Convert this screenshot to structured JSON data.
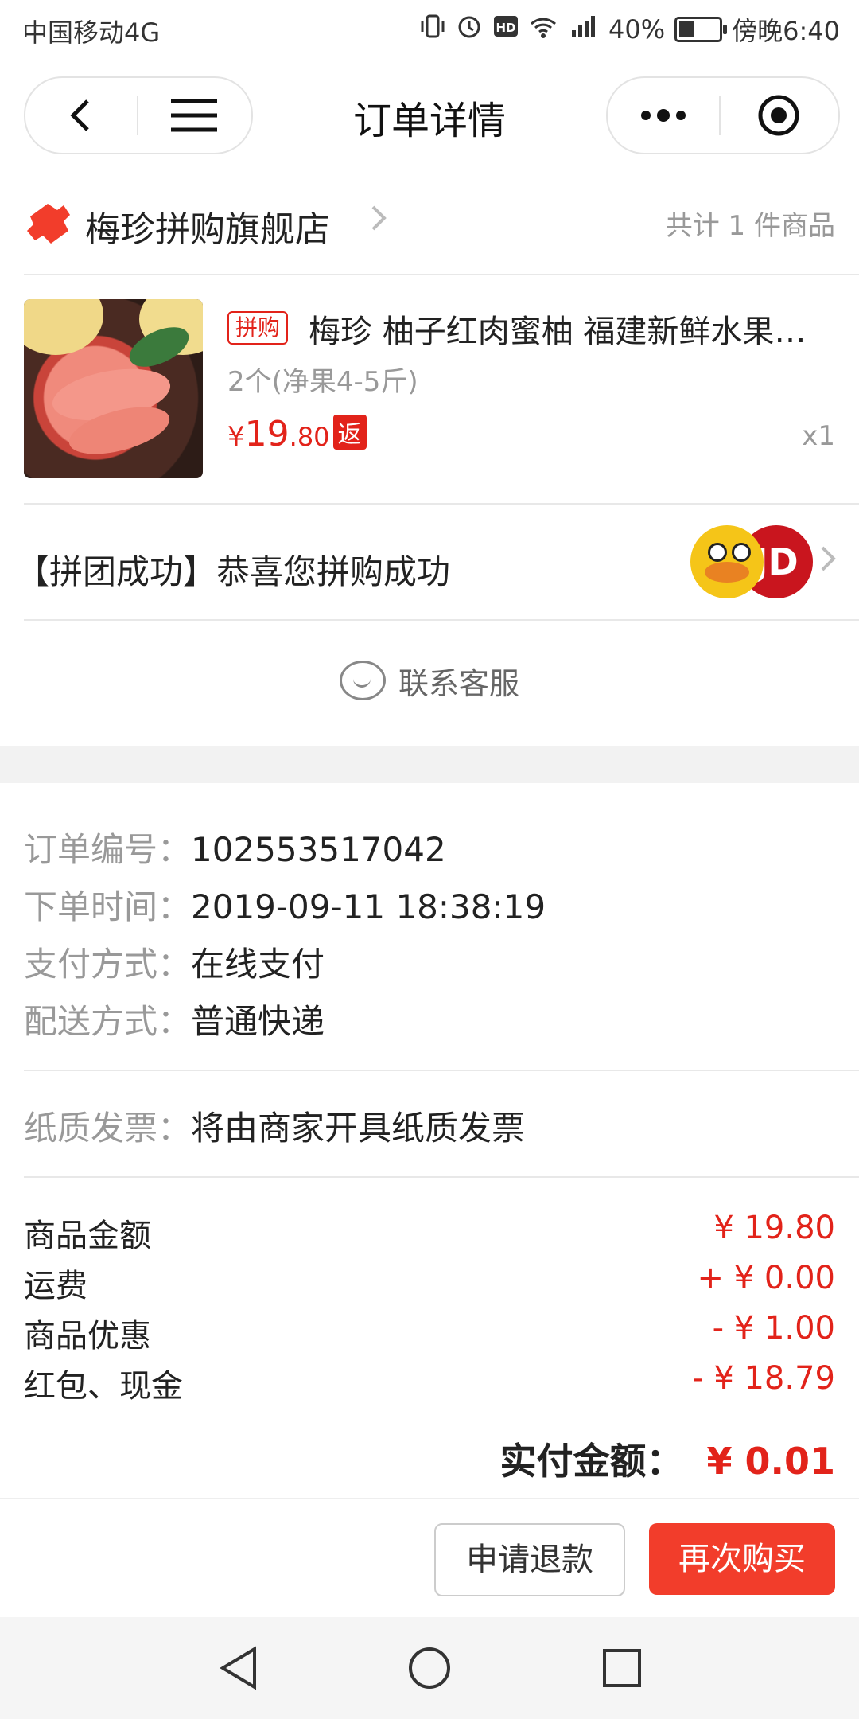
{
  "status_bar": {
    "carrier": "中国移动4G",
    "battery": "40%",
    "battery_fraction": 0.4,
    "time": "傍晚6:40"
  },
  "nav": {
    "title": "订单详情"
  },
  "store": {
    "name": "梅珍拼购旗舰店",
    "item_count": "共计 1 件商品"
  },
  "product": {
    "tag": "拼购",
    "title": "梅珍 柚子红肉蜜柚 福建新鲜水果应季",
    "spec": "2个(净果4-5斤)",
    "price_symbol": "¥",
    "price_int": "19",
    "price_dec": ".80",
    "rebate_tag": "返",
    "quantity": "x1"
  },
  "group": {
    "text": "【拼团成功】恭喜您拼购成功",
    "jd_avatar_text": "JD"
  },
  "contact": {
    "label": "联系客服"
  },
  "order_info": [
    {
      "label": "订单编号：",
      "value": "102553517042"
    },
    {
      "label": "下单时间：",
      "value": "2019-09-11 18:38:19"
    },
    {
      "label": "支付方式：",
      "value": "在线支付"
    },
    {
      "label": "配送方式：",
      "value": "普通快递"
    }
  ],
  "invoice": {
    "label": "纸质发票：",
    "value": "将由商家开具纸质发票"
  },
  "fees": [
    {
      "label": "商品金额",
      "value": "¥ 19.80"
    },
    {
      "label": "运费",
      "value": "+ ¥ 0.00"
    },
    {
      "label": "商品优惠",
      "value": "- ¥ 1.00"
    },
    {
      "label": "红包、现金",
      "value": "- ¥ 18.79"
    }
  ],
  "paid": {
    "label": "实付金额：",
    "value": "¥ 0.01"
  },
  "actions": {
    "refund": "申请退款",
    "rebuy": "再次购买"
  },
  "colors": {
    "accent": "#e2231a",
    "rebuy_button": "#f23d2b"
  }
}
